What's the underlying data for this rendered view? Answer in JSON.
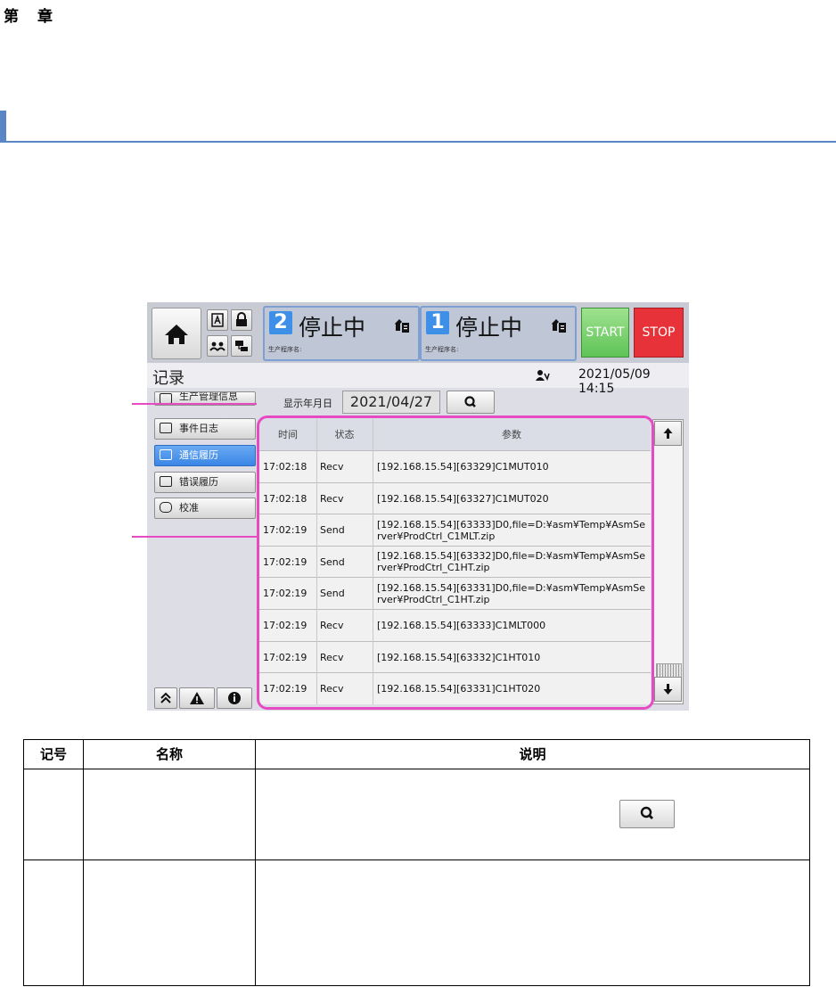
{
  "doc": {
    "chapter_label": "第　章"
  },
  "topbar": {
    "lanes": [
      {
        "number": "2",
        "status": "停止中",
        "program_label": "生产程序名:"
      },
      {
        "number": "1",
        "status": "停止中",
        "program_label": "生产程序名:"
      }
    ],
    "start_label": "START",
    "stop_label": "STOP",
    "start_color": "#5fc356",
    "stop_color": "#e8323a"
  },
  "header": {
    "title": "记录",
    "datetime": "2021/05/09 14:15"
  },
  "filter": {
    "date_label": "显示年月日",
    "date_value": "2021/04/27"
  },
  "sidebar": {
    "items": [
      {
        "label": "生产管理信息"
      },
      {
        "label": "事件日志"
      },
      {
        "label": "通信履历"
      },
      {
        "label": "错误履历"
      },
      {
        "label": "校准"
      }
    ],
    "active_index": 2
  },
  "log_table": {
    "columns": [
      "时间",
      "状态",
      "参数"
    ],
    "rows": [
      {
        "time": "17:02:18",
        "status": "Recv",
        "param": "[192.168.15.54][63329]C1MUT010"
      },
      {
        "time": "17:02:18",
        "status": "Recv",
        "param": "[192.168.15.54][63327]C1MUT020"
      },
      {
        "time": "17:02:19",
        "status": "Send",
        "param": "[192.168.15.54][63333]D0,file=D:¥asm¥Temp¥AsmServer¥ProdCtrl_C1MLT.zip"
      },
      {
        "time": "17:02:19",
        "status": "Send",
        "param": "[192.168.15.54][63332]D0,file=D:¥asm¥Temp¥AsmServer¥ProdCtrl_C1HT.zip"
      },
      {
        "time": "17:02:19",
        "status": "Send",
        "param": "[192.168.15.54][63331]D0,file=D:¥asm¥Temp¥AsmServer¥ProdCtrl_C1HT.zip"
      },
      {
        "time": "17:02:19",
        "status": "Recv",
        "param": "[192.168.15.54][63333]C1MLT000"
      },
      {
        "time": "17:02:19",
        "status": "Recv",
        "param": "[192.168.15.54][63332]C1HT010"
      },
      {
        "time": "17:02:19",
        "status": "Recv",
        "param": "[192.168.15.54][63331]C1HT020"
      }
    ]
  },
  "desc_table": {
    "headers": [
      "记号",
      "名称",
      "说明"
    ]
  },
  "colors": {
    "highlight": "#e64bc3",
    "section_accent": "#5b86c5",
    "active_tab": "#3a86e6"
  }
}
